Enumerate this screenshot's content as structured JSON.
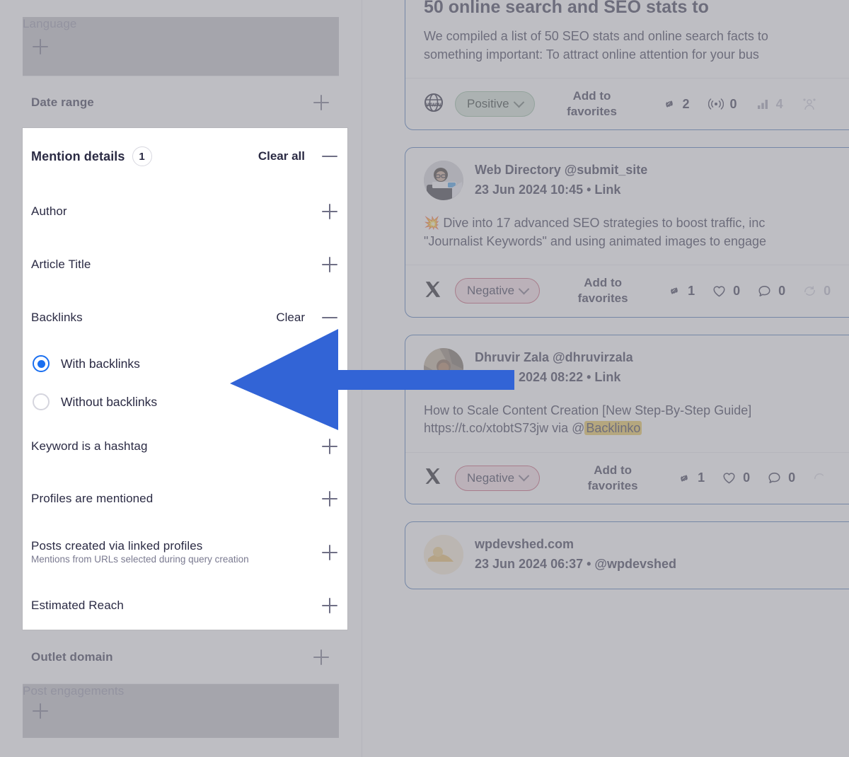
{
  "theme": {
    "accent_blue": "#3264d6",
    "card_border": "#3f6fb4",
    "radio_blue": "#1a6ff0",
    "positive_bg": "#cfe0d2",
    "negative_bg": "#f7dde4",
    "highlight_yellow": "#e8c24a",
    "dim_overlay": "rgba(150,150,158,0.62)"
  },
  "filters": {
    "above": [
      {
        "label": "Language",
        "control": "plus-icon",
        "dimmed": true
      },
      {
        "label": "Date range",
        "control": "plus-icon",
        "dimmed": false
      }
    ],
    "below": [
      {
        "label": "Outlet domain",
        "control": "plus-icon",
        "dimmed": false
      },
      {
        "label": "Post engagements",
        "control": "plus-icon",
        "dimmed": true
      }
    ]
  },
  "spotlight": {
    "header": {
      "title": "Mention details",
      "count": "1",
      "clear_all_label": "Clear all",
      "collapse_control": "minus-icon"
    },
    "rows": [
      {
        "label": "Author",
        "control": "plus-icon"
      },
      {
        "label": "Article Title",
        "control": "plus-icon"
      }
    ],
    "backlinks": {
      "label": "Backlinks",
      "clear_label": "Clear",
      "collapse_control": "minus-icon",
      "options": [
        {
          "label": "With backlinks",
          "selected": true
        },
        {
          "label": "Without backlinks",
          "selected": false
        }
      ]
    },
    "rows_after": [
      {
        "label": "Keyword is a hashtag",
        "sub": "",
        "control": "plus-icon"
      },
      {
        "label": "Profiles are mentioned",
        "sub": "",
        "control": "plus-icon"
      },
      {
        "label": "Posts created via linked profiles",
        "sub": "Mentions from URLs selected during query creation",
        "control": "plus-icon"
      },
      {
        "label": "Estimated Reach",
        "sub": "",
        "control": "plus-icon"
      }
    ]
  },
  "feed": {
    "favorites_label_line1": "Add to",
    "favorites_label_line2": "favorites",
    "cards": [
      {
        "kind": "article",
        "title": "50 online search and SEO stats to",
        "text_line1": "We compiled a list of 50 SEO stats and online search facts to",
        "text_line2": "something important: To attract online attention for your bus",
        "source_icon": "globe-www-icon",
        "sentiment": "Positive",
        "sentiment_type": "positive",
        "stats": [
          {
            "icon": "link-icon",
            "value": "2",
            "muted": false
          },
          {
            "icon": "broadcast-icon",
            "value": "0",
            "muted": false
          },
          {
            "icon": "bar-chart-icon",
            "value": "4",
            "muted": true
          },
          {
            "icon": "audience-icon",
            "value": "",
            "muted": true
          }
        ]
      },
      {
        "kind": "post",
        "author_name": "Web Directory @submit_site",
        "author_meta": "23 Jun 2024 10:45 • Link",
        "avatar": "avatar-web-directory",
        "text_line1": "💥 Dive into 17 advanced SEO strategies to boost traffic, inc",
        "text_line2": "\"Journalist Keywords\" and using animated images to engage",
        "source_icon": "x-twitter-icon",
        "sentiment": "Negative",
        "sentiment_type": "negative",
        "stats": [
          {
            "icon": "link-icon",
            "value": "1",
            "muted": false
          },
          {
            "icon": "heart-icon",
            "value": "0",
            "muted": false
          },
          {
            "icon": "comment-icon",
            "value": "0",
            "muted": false
          },
          {
            "icon": "repost-icon",
            "value": "0",
            "muted": true
          }
        ]
      },
      {
        "kind": "post",
        "author_name": "Dhruvir Zala @dhruvirzala",
        "author_meta": "23 Jun 2024 08:22 • Link",
        "avatar": "avatar-dhruvir-zala",
        "text_line1": "How to Scale Content Creation [New Step-By-Step Guide]",
        "text_line2_pre": "https://t.co/xtobtS73jw via @",
        "text_line2_highlight": "Backlinko",
        "source_icon": "x-twitter-icon",
        "sentiment": "Negative",
        "sentiment_type": "negative",
        "stats": [
          {
            "icon": "link-icon",
            "value": "1",
            "muted": false
          },
          {
            "icon": "heart-icon",
            "value": "0",
            "muted": false
          },
          {
            "icon": "comment-icon",
            "value": "0",
            "muted": false
          },
          {
            "icon": "repost-icon",
            "value": "",
            "muted": true
          }
        ]
      },
      {
        "kind": "post-partial",
        "author_name": "wpdevshed.com",
        "author_meta": "23 Jun 2024 06:37 • @wpdevshed",
        "avatar": "avatar-wpdevshed"
      }
    ]
  },
  "annotation": {
    "arrow": "left-pointing-arrow"
  }
}
